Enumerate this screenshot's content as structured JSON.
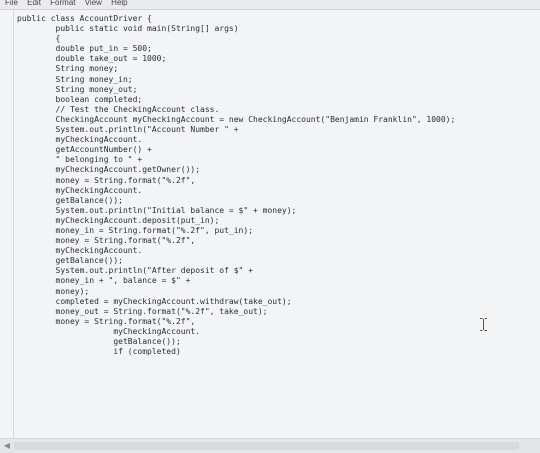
{
  "menu": {
    "items": [
      "File",
      "Edit",
      "Format",
      "View",
      "Help"
    ]
  },
  "editor": {
    "lines": [
      "public class AccountDriver {",
      "        public static void main(String[] args)",
      "        {",
      "        double put_in = 500;",
      "        double take_out = 1000;",
      "        String money;",
      "        String money_in;",
      "        String money_out;",
      "        boolean completed;",
      "        // Test the CheckingAccount class.",
      "        CheckingAccount myCheckingAccount = new CheckingAccount(\"Benjamin Franklin\", 1000);",
      "        System.out.println(\"Account Number \" +",
      "        myCheckingAccount.",
      "        getAccountNumber() +",
      "        \" belonging to \" +",
      "        myCheckingAccount.getOwner());",
      "        money = String.format(\"%.2f\",",
      "        myCheckingAccount.",
      "        getBalance());",
      "        System.out.println(\"Initial balance = $\" + money);",
      "        myCheckingAccount.deposit(put_in);",
      "        money_in = String.format(\"%.2f\", put_in);",
      "        money = String.format(\"%.2f\",",
      "        myCheckingAccount.",
      "        getBalance());",
      "        System.out.println(\"After deposit of $\" +",
      "        money_in + \", balance = $\" +",
      "        money);",
      "        completed = myCheckingAccount.withdraw(take_out);",
      "        money_out = String.format(\"%.2f\", take_out);",
      "        money = String.format(\"%.2f\",",
      "                    myCheckingAccount.",
      "                    getBalance());",
      "                    if (completed)"
    ]
  },
  "icons": {
    "cursor": "text-cursor-icon",
    "scroll_left": "scroll-left-arrow-icon"
  },
  "colors": {
    "background": "#f3f4f6",
    "text": "#2a2d33"
  }
}
